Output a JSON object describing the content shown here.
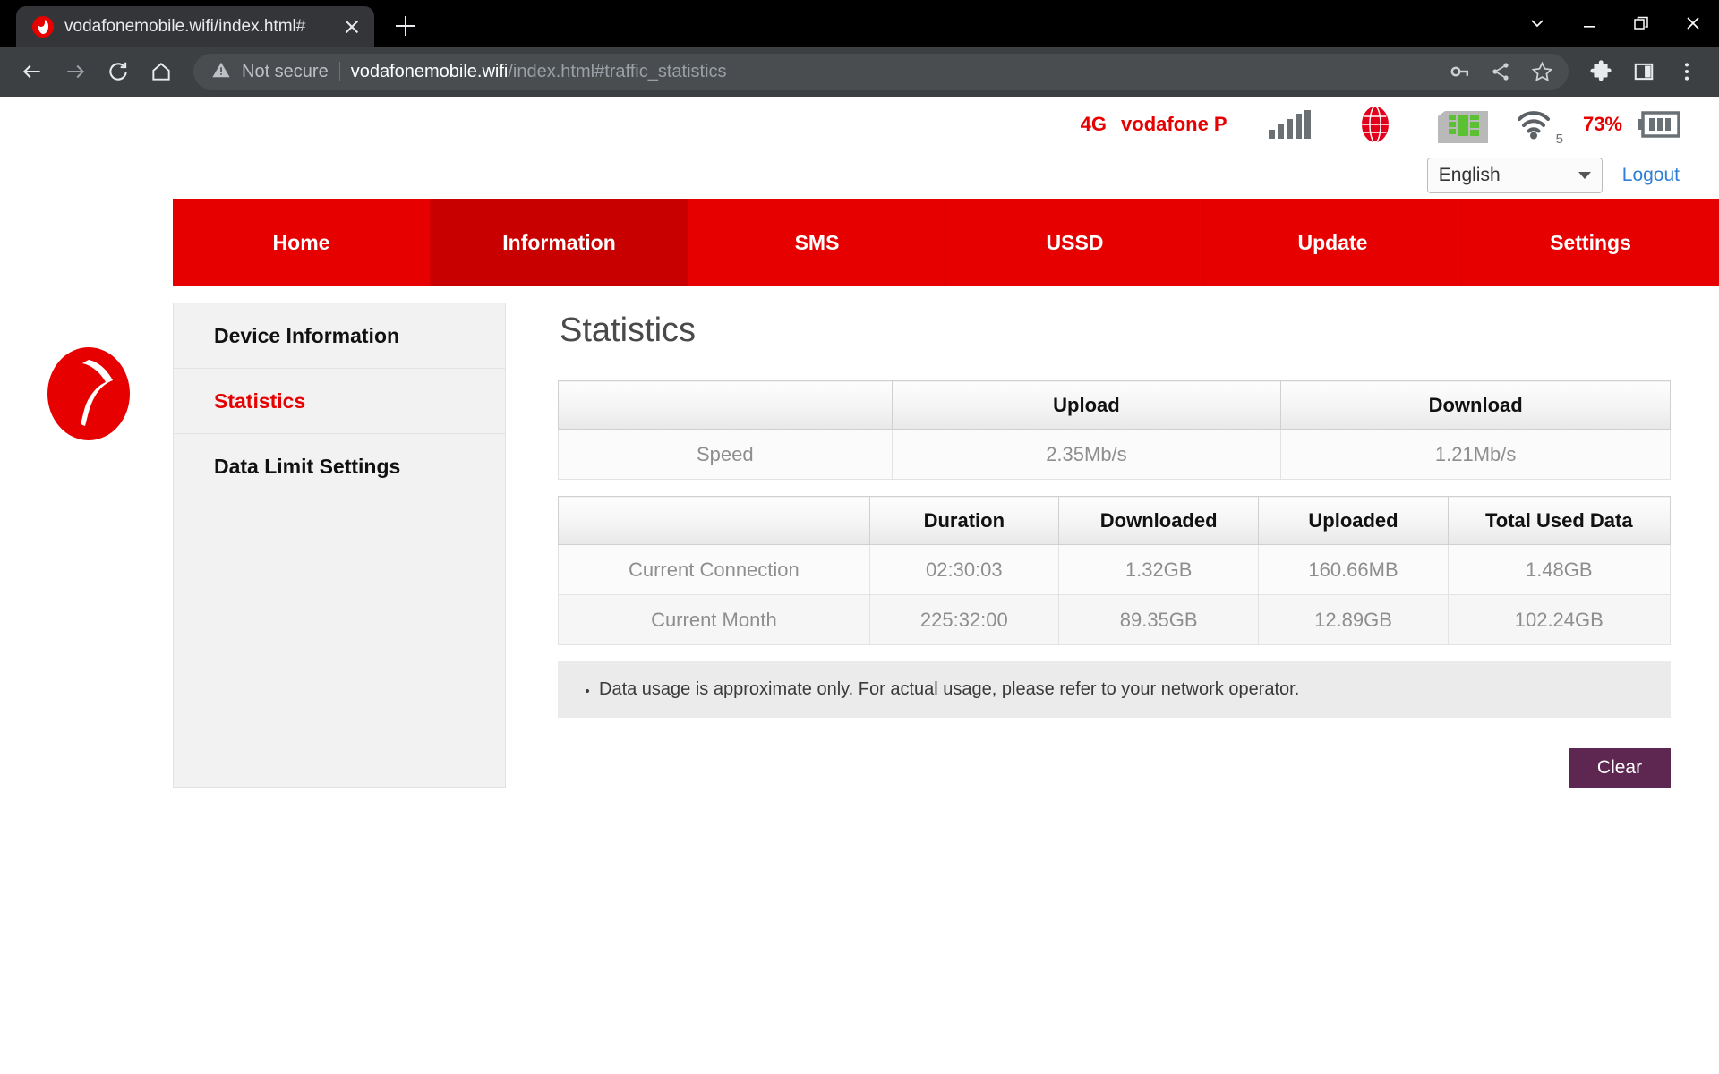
{
  "browser": {
    "tab": {
      "title": "vodafonemobile.wifi/index.html#",
      "favicon": "vodafone-favicon"
    },
    "new_tab_label": "+",
    "omnibox": {
      "security_label": "Not secure",
      "url_host": "vodafonemobile.wifi",
      "url_path": "/index.html#traffic_statistics"
    },
    "icons": {
      "back": "back-arrow-icon",
      "forward": "forward-arrow-icon",
      "reload": "reload-icon",
      "home": "home-icon",
      "warning": "warning-triangle-icon",
      "password": "key-icon",
      "share": "share-icon",
      "bookmark": "star-icon",
      "extensions": "puzzle-icon",
      "side_panel": "side-panel-icon",
      "menu": "three-dot-menu-icon",
      "tab_search": "chevron-down-icon",
      "minimize": "minimize-icon",
      "restore": "restore-icon",
      "close": "close-icon"
    }
  },
  "status": {
    "network_type": "4G",
    "operator": "vodafone P",
    "signal_bars": 5,
    "battery_percent": "73%",
    "wifi_clients": "5",
    "colors": {
      "brand_red": "#e60000",
      "sim_green": "#5cc033",
      "icon_gray": "#6b7075"
    }
  },
  "header": {
    "language": "English",
    "language_options": [
      "English"
    ],
    "logout_label": "Logout"
  },
  "nav": {
    "items": [
      {
        "label": "Home",
        "active": false
      },
      {
        "label": "Information",
        "active": true
      },
      {
        "label": "SMS",
        "active": false
      },
      {
        "label": "USSD",
        "active": false
      },
      {
        "label": "Update",
        "active": false
      },
      {
        "label": "Settings",
        "active": false
      }
    ]
  },
  "sidebar": {
    "items": [
      {
        "label": "Device Information",
        "active": false
      },
      {
        "label": "Statistics",
        "active": true
      },
      {
        "label": "Data Limit Settings",
        "active": false
      }
    ]
  },
  "main": {
    "title": "Statistics",
    "speed_table": {
      "headers": [
        "",
        "Upload",
        "Download"
      ],
      "rows": [
        {
          "label": "Speed",
          "upload": "2.35Mb/s",
          "download": "1.21Mb/s"
        }
      ]
    },
    "usage_table": {
      "headers": [
        "",
        "Duration",
        "Downloaded",
        "Uploaded",
        "Total Used Data"
      ],
      "rows": [
        {
          "label": "Current Connection",
          "duration": "02:30:03",
          "downloaded": "1.32GB",
          "uploaded": "160.66MB",
          "total": "1.48GB"
        },
        {
          "label": "Current Month",
          "duration": "225:32:00",
          "downloaded": "89.35GB",
          "uploaded": "12.89GB",
          "total": "102.24GB"
        }
      ]
    },
    "note": "Data usage is approximate only. For actual usage, please refer to your network operator.",
    "clear_button": "Clear"
  }
}
